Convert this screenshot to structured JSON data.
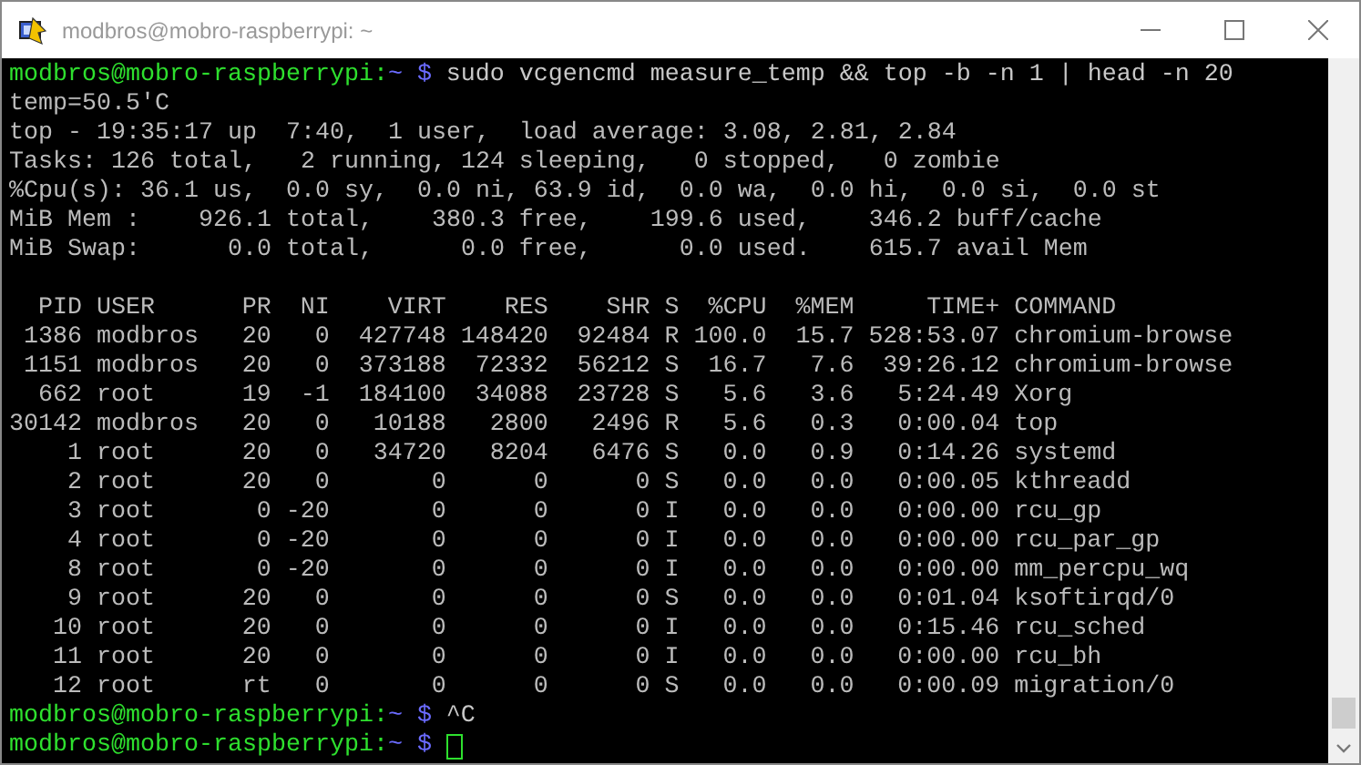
{
  "window": {
    "title": "modbros@mobro-raspberrypi: ~"
  },
  "terminal": {
    "lines": [
      {
        "kind": "prompt",
        "user_host": "modbros@mobro-raspberrypi:",
        "path": "~",
        "symbol": "$",
        "command": "sudo vcgencmd measure_temp && top -b -n 1 | head -n 20",
        "cursor": false
      },
      {
        "kind": "output",
        "text": "temp=50.5'C"
      },
      {
        "kind": "output",
        "text": "top - 19:35:17 up  7:40,  1 user,  load average: 3.08, 2.81, 2.84"
      },
      {
        "kind": "output",
        "text": "Tasks: 126 total,   2 running, 124 sleeping,   0 stopped,   0 zombie"
      },
      {
        "kind": "output",
        "text": "%Cpu(s): 36.1 us,  0.0 sy,  0.0 ni, 63.9 id,  0.0 wa,  0.0 hi,  0.0 si,  0.0 st"
      },
      {
        "kind": "output",
        "text": "MiB Mem :    926.1 total,    380.3 free,    199.6 used,    346.2 buff/cache"
      },
      {
        "kind": "output",
        "text": "MiB Swap:      0.0 total,      0.0 free,      0.0 used.    615.7 avail Mem"
      },
      {
        "kind": "blank"
      },
      {
        "kind": "table",
        "columns": [
          "PID",
          "USER",
          "PR",
          "NI",
          "VIRT",
          "RES",
          "SHR",
          "S",
          "%CPU",
          "%MEM",
          "TIME+",
          "COMMAND"
        ],
        "rows": [
          [
            "1386",
            "modbros",
            "20",
            "0",
            "427748",
            "148420",
            "92484",
            "R",
            "100.0",
            "15.7",
            "528:53.07",
            "chromium-browse"
          ],
          [
            "1151",
            "modbros",
            "20",
            "0",
            "373188",
            "72332",
            "56212",
            "S",
            "16.7",
            "7.6",
            "39:26.12",
            "chromium-browse"
          ],
          [
            "662",
            "root",
            "19",
            "-1",
            "184100",
            "34088",
            "23728",
            "S",
            "5.6",
            "3.6",
            "5:24.49",
            "Xorg"
          ],
          [
            "30142",
            "modbros",
            "20",
            "0",
            "10188",
            "2800",
            "2496",
            "R",
            "5.6",
            "0.3",
            "0:00.04",
            "top"
          ],
          [
            "1",
            "root",
            "20",
            "0",
            "34720",
            "8204",
            "6476",
            "S",
            "0.0",
            "0.9",
            "0:14.26",
            "systemd"
          ],
          [
            "2",
            "root",
            "20",
            "0",
            "0",
            "0",
            "0",
            "S",
            "0.0",
            "0.0",
            "0:00.05",
            "kthreadd"
          ],
          [
            "3",
            "root",
            "0",
            "-20",
            "0",
            "0",
            "0",
            "I",
            "0.0",
            "0.0",
            "0:00.00",
            "rcu_gp"
          ],
          [
            "4",
            "root",
            "0",
            "-20",
            "0",
            "0",
            "0",
            "I",
            "0.0",
            "0.0",
            "0:00.00",
            "rcu_par_gp"
          ],
          [
            "8",
            "root",
            "0",
            "-20",
            "0",
            "0",
            "0",
            "I",
            "0.0",
            "0.0",
            "0:00.00",
            "mm_percpu_wq"
          ],
          [
            "9",
            "root",
            "20",
            "0",
            "0",
            "0",
            "0",
            "S",
            "0.0",
            "0.0",
            "0:01.04",
            "ksoftirqd/0"
          ],
          [
            "10",
            "root",
            "20",
            "0",
            "0",
            "0",
            "0",
            "I",
            "0.0",
            "0.0",
            "0:15.46",
            "rcu_sched"
          ],
          [
            "11",
            "root",
            "20",
            "0",
            "0",
            "0",
            "0",
            "I",
            "0.0",
            "0.0",
            "0:00.00",
            "rcu_bh"
          ],
          [
            "12",
            "root",
            "rt",
            "0",
            "0",
            "0",
            "0",
            "S",
            "0.0",
            "0.0",
            "0:00.09",
            "migration/0"
          ]
        ]
      },
      {
        "kind": "prompt",
        "user_host": "modbros@mobro-raspberrypi:",
        "path": "~",
        "symbol": "$",
        "command": "^C",
        "cursor": false
      },
      {
        "kind": "prompt",
        "user_host": "modbros@mobro-raspberrypi:",
        "path": "~",
        "symbol": "$",
        "cursor": true
      }
    ]
  }
}
